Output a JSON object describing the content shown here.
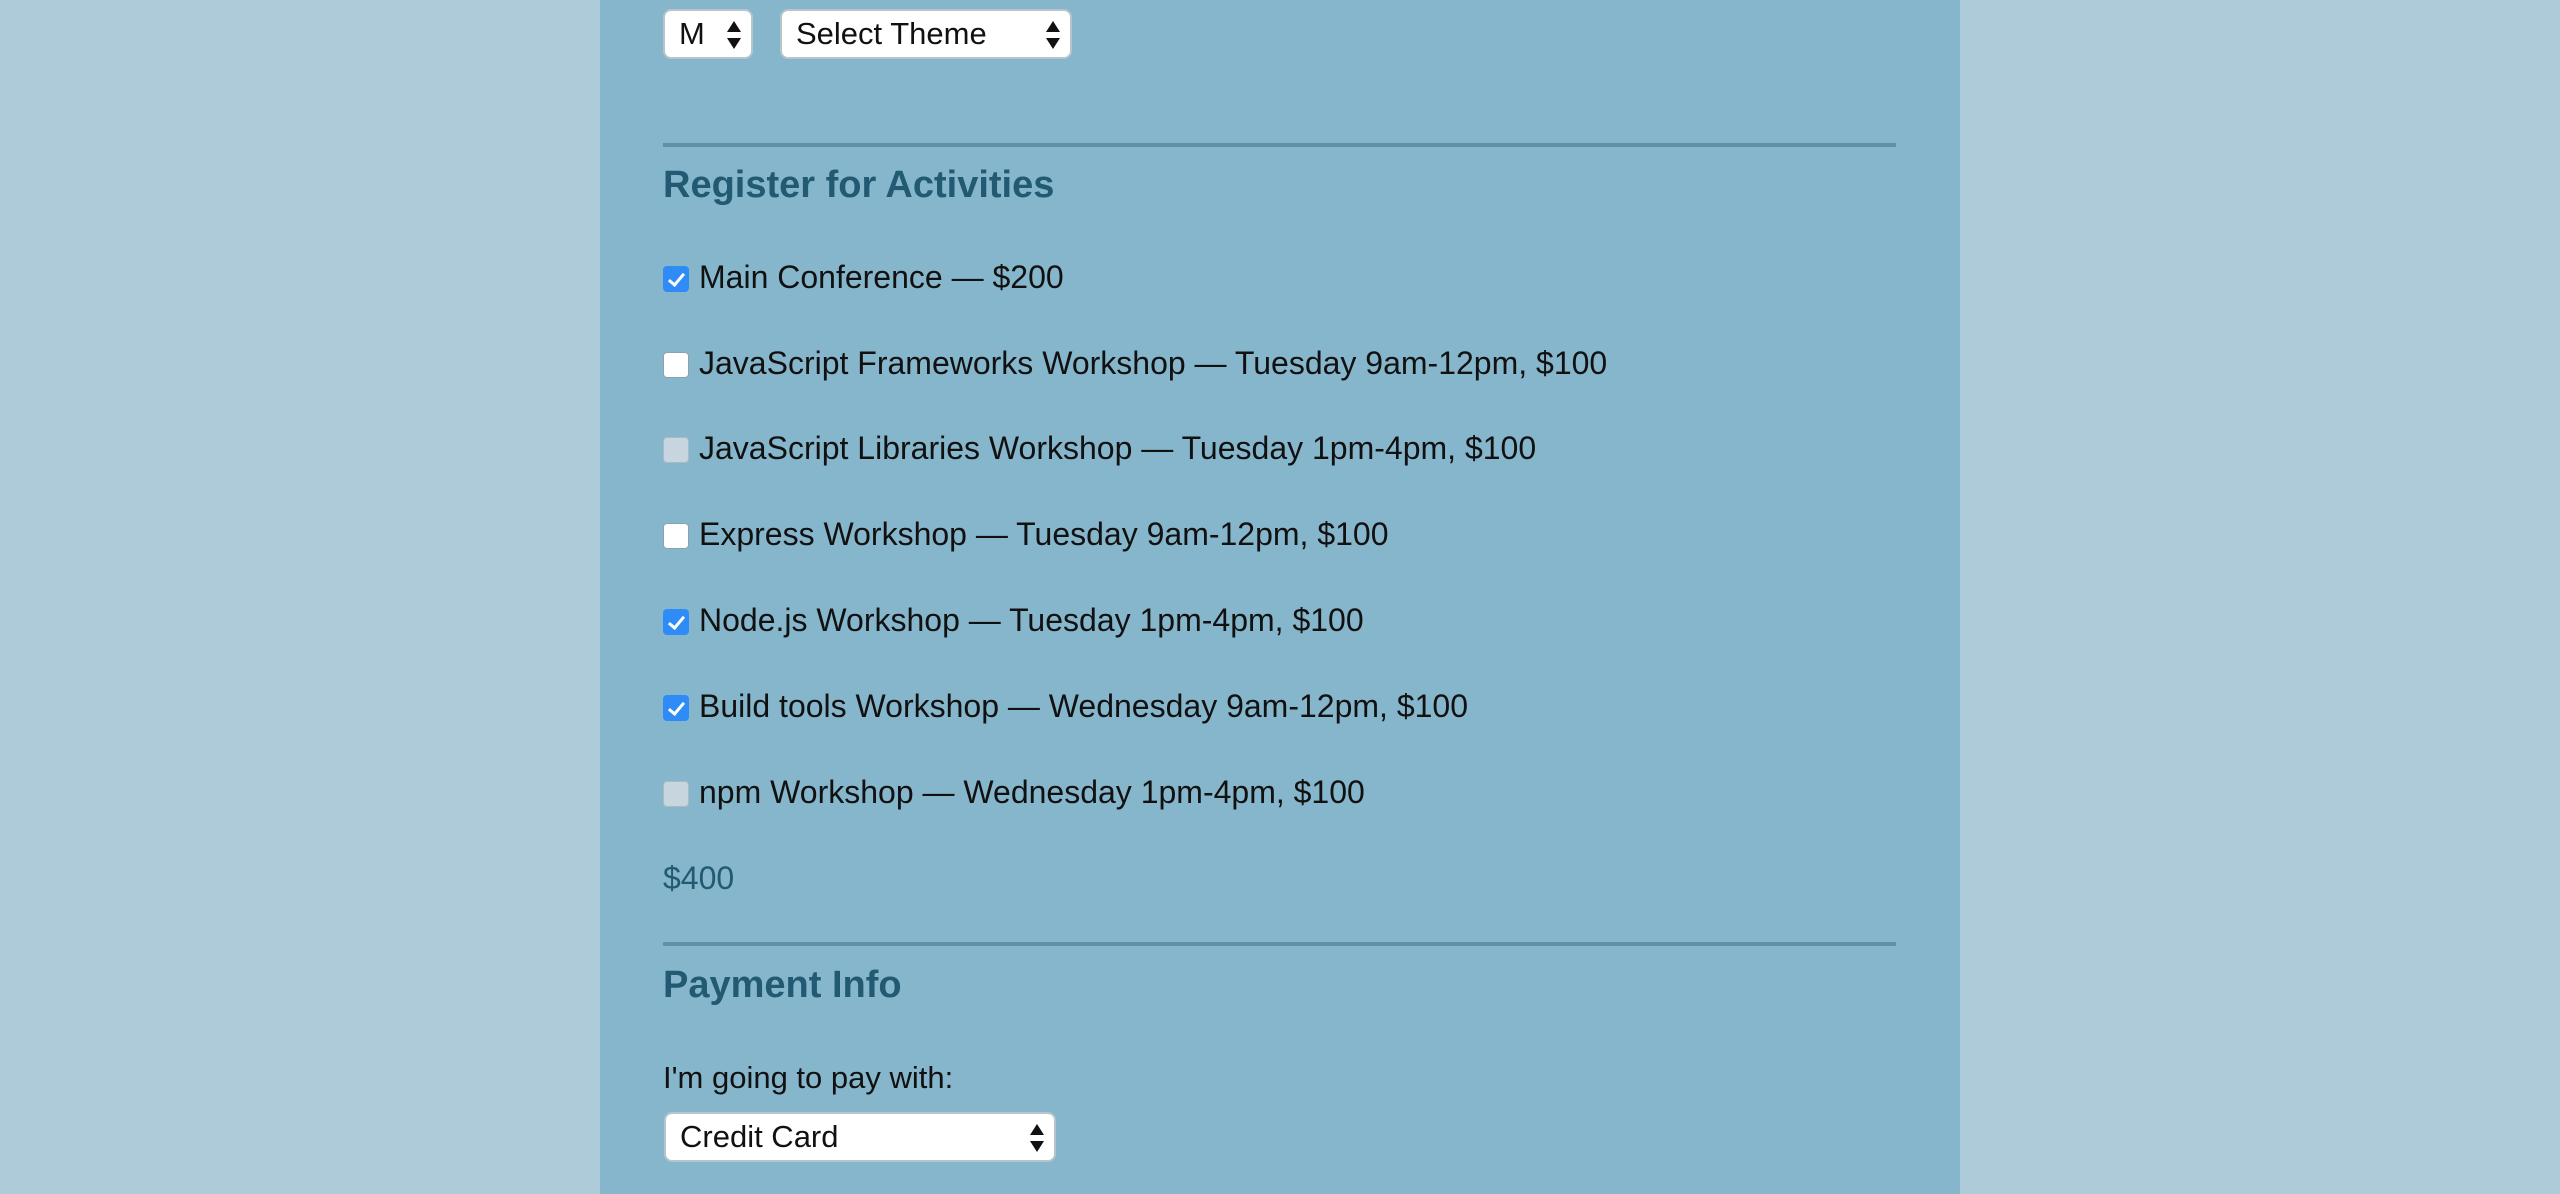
{
  "shirt": {
    "size_value": "M",
    "theme_value": "Select Theme"
  },
  "activities": {
    "heading": "Register for Activities",
    "items": [
      {
        "label": "Main Conference — $200",
        "checked": true,
        "disabled": false
      },
      {
        "label": "JavaScript Frameworks Workshop — Tuesday 9am-12pm, $100",
        "checked": false,
        "disabled": false
      },
      {
        "label": "JavaScript Libraries Workshop — Tuesday 1pm-4pm, $100",
        "checked": false,
        "disabled": true
      },
      {
        "label": "Express Workshop — Tuesday 9am-12pm, $100",
        "checked": false,
        "disabled": false
      },
      {
        "label": "Node.js Workshop — Tuesday 1pm-4pm, $100",
        "checked": true,
        "disabled": false
      },
      {
        "label": "Build tools Workshop — Wednesday 9am-12pm, $100",
        "checked": true,
        "disabled": false
      },
      {
        "label": "npm Workshop — Wednesday 1pm-4pm, $100",
        "checked": false,
        "disabled": true
      }
    ],
    "total": "$400"
  },
  "payment": {
    "heading": "Payment Info",
    "pay_label": "I'm going to pay with:",
    "method_value": "Credit Card"
  },
  "colors": {
    "page_background": "#aecbd9",
    "panel_background": "#86b6cb",
    "heading_color": "#215a72",
    "checkbox_checked": "#2f8cf6"
  }
}
